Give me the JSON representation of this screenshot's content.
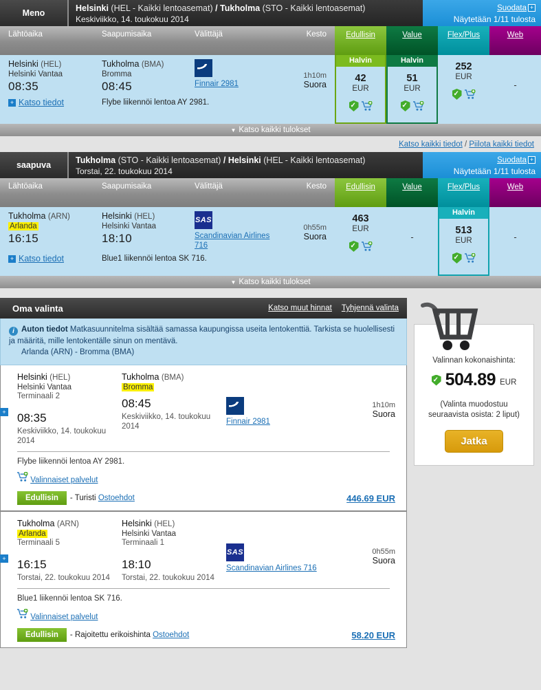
{
  "results": [
    {
      "direction_label": "Meno",
      "route_from": "Helsinki",
      "route_from_sub": "(HEL - Kaikki lentoasemat)",
      "route_sep": "/",
      "route_to": "Tukholma",
      "route_to_sub": "(STO - Kaikki lentoasemat)",
      "date": "Keskiviikko, 14. toukokuu 2014",
      "filter_label": "Suodata",
      "results_count": "Näytetään 1/11 tulosta",
      "columns": {
        "departure": "Lähtöaika",
        "arrival": "Saapumisaika",
        "carrier": "Välittäjä",
        "duration": "Kesto"
      },
      "fare_columns": [
        "Edullisin",
        "Value",
        "Flex/Plus",
        "Web"
      ],
      "flight": {
        "dep_city": "Helsinki",
        "dep_code": "(HEL)",
        "dep_airport": "Helsinki Vantaa",
        "dep_airport_highlight": false,
        "dep_time": "08:35",
        "arr_city": "Tukholma",
        "arr_code": "(BMA)",
        "arr_airport": "Bromma",
        "arr_airport_highlight": false,
        "arr_time": "08:45",
        "carrier_logo": "finnair-logo",
        "carrier_name": "Finnair 2981",
        "duration": "1h10m",
        "stops": "Suora",
        "details_link": "Katso tiedot",
        "operated_by": "Flybe liikennöi lentoa AY 2981."
      },
      "fares": [
        {
          "tag": "Halvin",
          "tag_color": "#7cbb1f",
          "price": "42",
          "currency": "EUR",
          "selected": true,
          "icons": [
            "shield-check-icon",
            "add-to-cart-icon"
          ]
        },
        {
          "tag": "Halvin",
          "tag_color": "#0e7a43",
          "price": "51",
          "currency": "EUR",
          "selected": true,
          "icons": [
            "shield-check-icon",
            "add-to-cart-icon"
          ]
        },
        {
          "tag": "",
          "tag_color": "",
          "price": "252",
          "currency": "EUR",
          "selected": false,
          "icons": [
            "shield-check-icon",
            "add-to-cart-icon"
          ]
        },
        {
          "tag": "",
          "tag_color": "",
          "price": "-",
          "currency": "",
          "selected": false,
          "icons": []
        }
      ],
      "view_all": "Katso kaikki tulokset"
    },
    {
      "direction_label": "saapuva",
      "route_from": "Tukholma",
      "route_from_sub": "(STO - Kaikki lentoasemat)",
      "route_sep": "/",
      "route_to": "Helsinki",
      "route_to_sub": "(HEL - Kaikki lentoasemat)",
      "date": "Torstai, 22. toukokuu 2014",
      "filter_label": "Suodata",
      "results_count": "Näytetään 1/11 tulosta",
      "columns": {
        "departure": "Lähtöaika",
        "arrival": "Saapumisaika",
        "carrier": "Välittäjä",
        "duration": "Kesto"
      },
      "fare_columns": [
        "Edullisin",
        "Value",
        "Flex/Plus",
        "Web"
      ],
      "flight": {
        "dep_city": "Tukholma",
        "dep_code": "(ARN)",
        "dep_airport": "Arlanda",
        "dep_airport_highlight": true,
        "dep_time": "16:15",
        "arr_city": "Helsinki",
        "arr_code": "(HEL)",
        "arr_airport": "Helsinki Vantaa",
        "arr_airport_highlight": false,
        "arr_time": "18:10",
        "carrier_logo": "sas-logo",
        "carrier_name": "Scandinavian Airlines 716",
        "duration": "0h55m",
        "stops": "Suora",
        "details_link": "Katso tiedot",
        "operated_by": "Blue1 liikennöi lentoa SK 716."
      },
      "fares": [
        {
          "tag": "",
          "tag_color": "",
          "price": "463",
          "currency": "EUR",
          "selected": false,
          "icons": [
            "shield-check-icon",
            "add-to-cart-icon"
          ]
        },
        {
          "tag": "",
          "tag_color": "",
          "price": "-",
          "currency": "",
          "selected": false,
          "icons": []
        },
        {
          "tag": "Halvin",
          "tag_color": "#18b0bb",
          "price": "513",
          "currency": "EUR",
          "selected": true,
          "icons": [
            "shield-check-icon",
            "add-to-cart-icon"
          ]
        },
        {
          "tag": "",
          "tag_color": "",
          "price": "-",
          "currency": "",
          "selected": false,
          "icons": []
        }
      ],
      "view_all": "Katso kaikki tulokset"
    }
  ],
  "detail_links": {
    "show_all": "Katso kaikki tiedot",
    "separator": "/",
    "hide_all": "Piilota kaikki tiedot"
  },
  "selection": {
    "title": "Oma valinta",
    "link_other_prices": "Katso muut hinnat",
    "link_clear": "Tyhjennä valinta",
    "alert": {
      "icon": "info-icon",
      "bold": "Auton tiedot",
      "text": "Matkasuunnitelma sisältää samassa kaupungissa useita lentokenttiä. Tarkista se huolellisesti ja määritä, mille lentokentälle sinun on mentävä.",
      "line2": "Arlanda (ARN) - Bromma (BMA)"
    },
    "legs": [
      {
        "dep_city": "Helsinki",
        "dep_code": "(HEL)",
        "dep_airport": "Helsinki Vantaa",
        "dep_airport_highlight": false,
        "dep_terminal": "Terminaali 2",
        "dep_time": "08:35",
        "dep_date": "Keskiviikko, 14. toukokuu 2014",
        "arr_city": "Tukholma",
        "arr_code": "(BMA)",
        "arr_airport": "Bromma",
        "arr_airport_highlight": true,
        "arr_terminal": "",
        "arr_time": "08:45",
        "arr_date": "Keskiviikko, 14. toukokuu 2014",
        "carrier_logo": "finnair-logo",
        "carrier_name": "Finnair 2981",
        "duration": "1h10m",
        "stops": "Suora",
        "operated_by": "Flybe liikennöi lentoa AY 2981.",
        "optional_services": "Valinnaiset palvelut",
        "fare_badge": "Edullisin",
        "fare_class": "- Turisti -",
        "terms_link": "Ostoehdot",
        "price": "446.69 EUR"
      },
      {
        "dep_city": "Tukholma",
        "dep_code": "(ARN)",
        "dep_airport": "Arlanda",
        "dep_airport_highlight": true,
        "dep_terminal": "Terminaali 5",
        "dep_time": "16:15",
        "dep_date": "Torstai, 22. toukokuu 2014",
        "arr_city": "Helsinki",
        "arr_code": "(HEL)",
        "arr_airport": "Helsinki Vantaa",
        "arr_airport_highlight": false,
        "arr_terminal": "Terminaali 1",
        "arr_time": "18:10",
        "arr_date": "Torstai, 22. toukokuu 2014",
        "carrier_logo": "sas-logo",
        "carrier_name": "Scandinavian Airlines 716",
        "duration": "0h55m",
        "stops": "Suora",
        "operated_by": "Blue1 liikennöi lentoa SK 716.",
        "optional_services": "Valinnaiset palvelut",
        "fare_badge": "Edullisin",
        "fare_class": "- Rajoitettu erikoishinta -",
        "terms_link": "Ostoehdot",
        "price": "58.20 EUR"
      }
    ]
  },
  "cart": {
    "icon": "shopping-cart-icon",
    "total_label": "Valinnan kokonaishinta:",
    "total_amount": "504.89",
    "currency": "EUR",
    "note": "(Valinta muodostuu seuraavista osista: 2 liput)",
    "continue_button": "Jatka"
  },
  "colors": {
    "edullisin": "#7cbb1f",
    "value": "#0e7a43",
    "flexplus": "#18b0bb",
    "web": "#8d007a",
    "accent_blue": "#1b8fd6",
    "row_blue": "#bfe0f2",
    "highlight_yellow": "#fbf000"
  }
}
